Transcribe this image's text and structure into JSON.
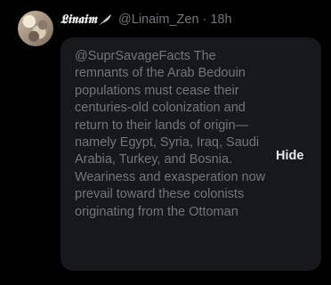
{
  "author": {
    "display_name": "𝕷𝖎𝖓𝖆𝖎𝖒",
    "handle": "@Linaim_Zen",
    "separator": "·",
    "time": "18h"
  },
  "hidden_reply": {
    "text": "@SuprSavageFacts The remnants of the Arab Bedouin populations must cease their centuries-old colonization and return to their lands of origin—namely Egypt, Syria, Iraq, Saudi Arabia, Turkey, and Bosnia. Weariness and exasperation now prevail toward these colonists originating from the Ottoman",
    "hide_label": "Hide"
  },
  "colors": {
    "background": "#000000",
    "card": "#16181c",
    "muted_text": "#71767b",
    "primary_text": "#e7e9ea"
  },
  "icons": {
    "name_decoration": "feather-icon"
  }
}
